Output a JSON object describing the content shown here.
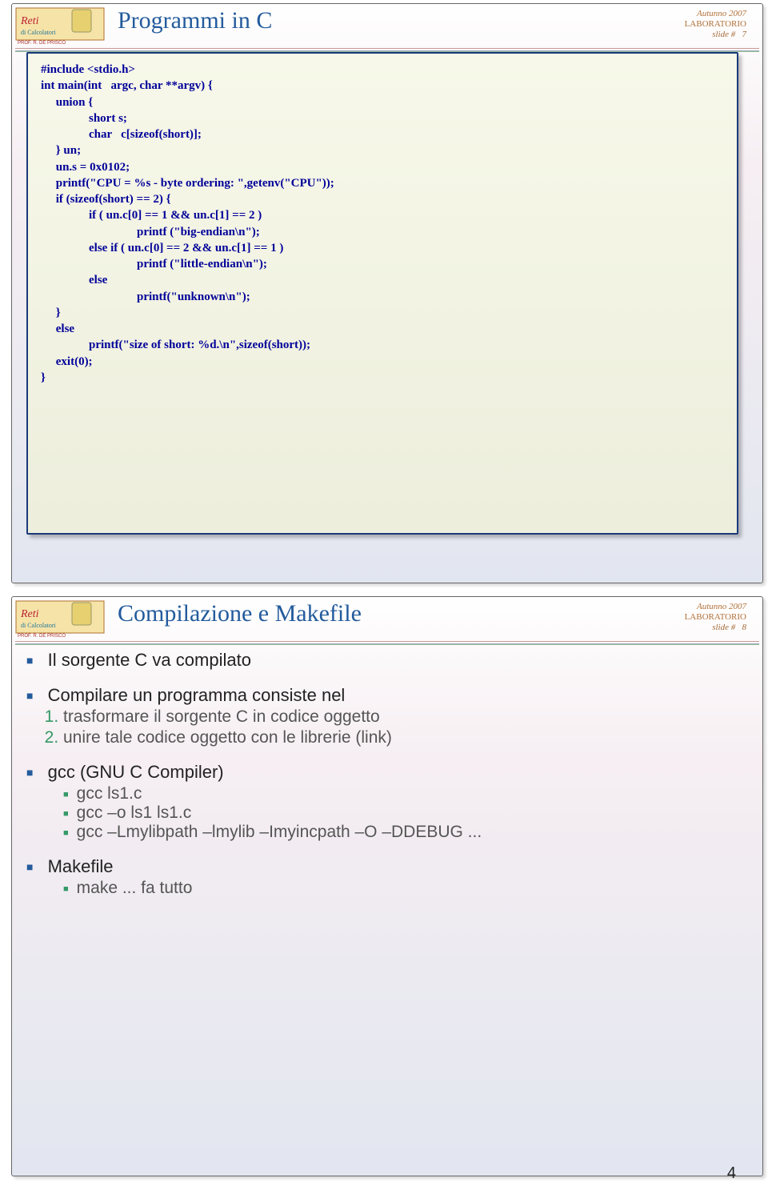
{
  "slide1": {
    "title": "Programmi in C",
    "meta": {
      "term": "Autunno 2007",
      "lab": "LABORATORIO",
      "slidelabel": "slide #",
      "num": "7"
    },
    "code": "#include <stdio.h>\nint main(int   argc, char **argv) {\n     union {\n                short s;\n                char   c[sizeof(short)];\n     } un;\n     un.s = 0x0102;\n     printf(\"CPU = %s - byte ordering: \",getenv(\"CPU\"));\n     if (sizeof(short) == 2) {\n                if ( un.c[0] == 1 && un.c[1] == 2 )\n                                printf (\"big-endian\\n\");\n                else if ( un.c[0] == 2 && un.c[1] == 1 )\n                                printf (\"little-endian\\n\");\n                else\n                                printf(\"unknown\\n\");\n     }\n     else\n                printf(\"size of short: %d.\\n\",sizeof(short));\n     exit(0);\n}"
  },
  "slide2": {
    "title": "Compilazione e Makefile",
    "meta": {
      "term": "Autunno 2007",
      "lab": "LABORATORIO",
      "slidelabel": "slide #",
      "num": "8"
    },
    "bullets": {
      "b1": "Il sorgente C va compilato",
      "b2": "Compilare un programma consiste nel",
      "b2_1": "trasformare il sorgente C in codice oggetto",
      "b2_2": "unire tale codice oggetto con le librerie (link)",
      "b3": "gcc (GNU C Compiler)",
      "b3_1": "gcc ls1.c",
      "b3_2": "gcc –o ls1 ls1.c",
      "b3_3": "gcc –Lmylibpath –lmylib –Imyincpath –O –DDEBUG ...",
      "b4": "Makefile",
      "b4_1": "make ... fa tutto"
    }
  },
  "pageNumber": "4"
}
